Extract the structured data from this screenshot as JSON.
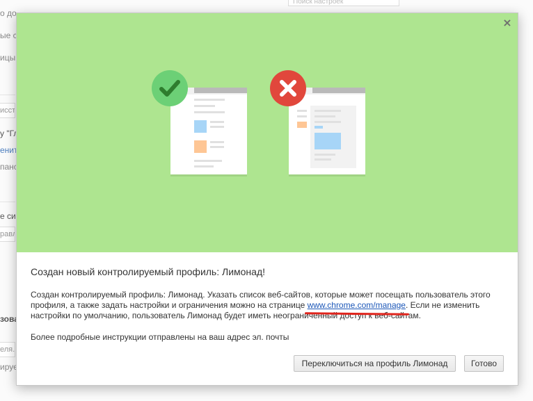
{
  "background_page": {
    "fragments": [
      "о до",
      "ые с",
      "ицы",
      "исста",
      "у \"Гл",
      "енити",
      "панс",
      "е сис",
      "равл",
      "зова",
      "еля...",
      "ируем"
    ],
    "search_placeholder": "Поиск настроек"
  },
  "dialog": {
    "close_label": "×",
    "title": "Создан новый контролируемый профиль: Лимонад!",
    "body_part1": "Создан контролируемый профиль: Лимонад. Указать список веб-сайтов, которые может посещать пользователь этого профиля, а также задать настройки и ограничения можно на странице ",
    "link_text": "www.chrome.com/manage",
    "body_part2": ". Если не изменить настройки по умолчанию, пользователь Лимонад будет иметь неограниченный доступ к веб-сайтам.",
    "note": "Более подробные инструкции отправлены на ваш адрес эл. почты",
    "switch_button_label": "Переключиться на профиль Лимонад",
    "ok_button_label": "Готово"
  },
  "colors": {
    "hero_background": "#aee590",
    "ok_badge": "#6cd076",
    "bad_badge": "#e1473c",
    "link": "#1c57b8",
    "annotation_underline": "#e0241c"
  },
  "icons": {
    "allowed_badge": "checkmark-icon",
    "blocked_badge": "cross-icon",
    "close": "close-icon"
  }
}
